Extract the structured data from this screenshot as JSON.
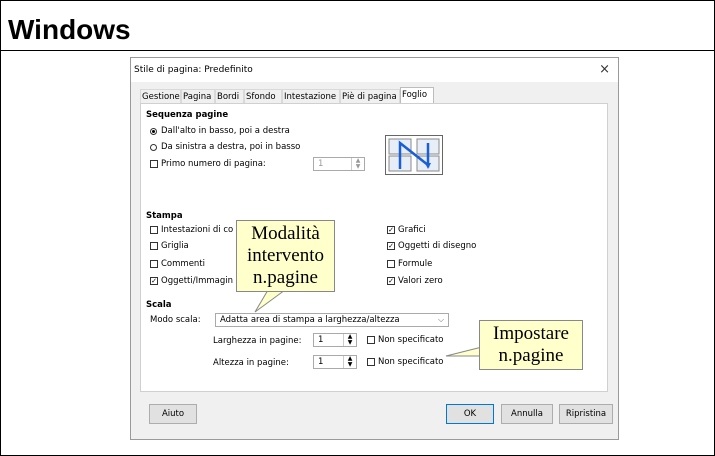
{
  "slide": {
    "title": "Windows"
  },
  "dialog": {
    "title": "Stile di pagina: Predefinito",
    "close": "×",
    "tabs": [
      "Gestione",
      "Pagina",
      "Bordi",
      "Sfondo",
      "Intestazione",
      "Piè di pagina",
      "Foglio"
    ],
    "active_tab": "Foglio",
    "sequence": {
      "heading": "Sequenza pagine",
      "option1": "Dall'alto in basso, poi a destra",
      "option2": "Da sinistra a destra, poi in basso",
      "first_page_label": "Primo numero di pagina:",
      "first_page_value": "1"
    },
    "print": {
      "heading": "Stampa",
      "headers": "Intestazioni di co",
      "grid": "Griglia",
      "comments": "Commenti",
      "objects": "Oggetti/Immagin",
      "charts": "Grafici",
      "drawing": "Oggetti di disegno",
      "formulas": "Formule",
      "zero": "Valori zero"
    },
    "scale": {
      "heading": "Scala",
      "mode_label": "Modo scala:",
      "mode_value": "Adatta area di stampa a larghezza/altezza",
      "width_label": "Larghezza in pagine:",
      "width_value": "1",
      "height_label": "Altezza in pagine:",
      "height_value": "1",
      "unspecified": "Non specificato"
    },
    "buttons": {
      "help": "Aiuto",
      "ok": "OK",
      "cancel": "Annulla",
      "reset": "Ripristina"
    }
  },
  "callouts": {
    "mode": [
      "Modalità",
      "intervento",
      "n.pagine"
    ],
    "set": [
      "Impostare",
      "n.pagine"
    ]
  }
}
